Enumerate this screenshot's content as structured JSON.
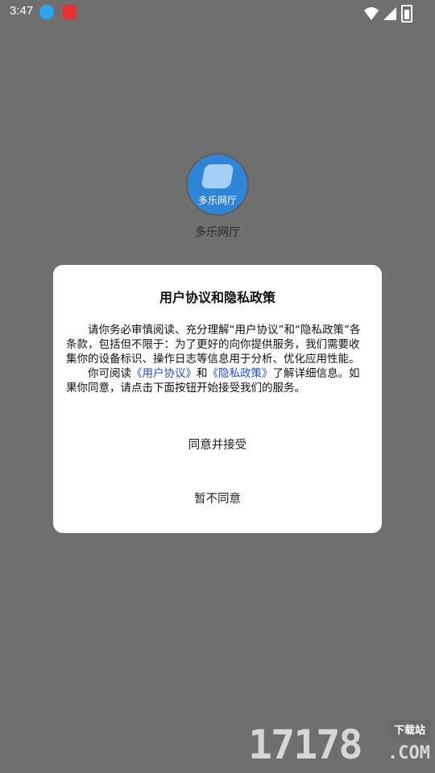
{
  "status_bar": {
    "time": "3:47",
    "icons": [
      "download-icon",
      "app-notification-icon",
      "wifi-icon",
      "signal-icon",
      "battery-icon"
    ]
  },
  "app": {
    "logo_text": "多乐网厅",
    "name": "多乐网厅"
  },
  "dialog": {
    "title": "用户协议和隐私政策",
    "para1": "请你务必审慎阅读、充分理解“用户协议”和“隐私政策”各条款，包括但不限于：为了更好的向你提供服务，我们需要收集你的设备标识、操作日志等信息用于分析、优化应用性能。",
    "para2_prefix": "你可阅读",
    "link_user": "《用户协议》",
    "and_text": "和",
    "link_privacy": "《隐私政策》",
    "para2_suffix": "了解详细信息。如果你同意，请点击下面按钮开始接受我们的服务。",
    "accept_label": "同意并接受",
    "decline_label": "暂不同意"
  },
  "watermark": {
    "number": "17178",
    "tag": "下载站",
    "com": ".COM"
  },
  "colors": {
    "overlay": "#6f6f6f",
    "link": "#1f4fd8",
    "logo": "#2f86d8"
  }
}
